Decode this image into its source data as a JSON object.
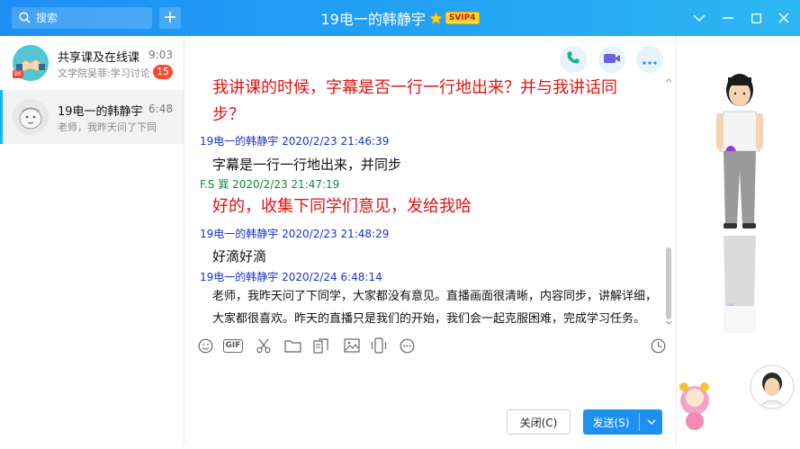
{
  "search": {
    "placeholder": "搜索"
  },
  "window": {
    "title": "19电一的韩静宇",
    "vip_badge": "SVIP4"
  },
  "conversations": [
    {
      "name": "共享课及在线课",
      "time": "9:03",
      "preview": "文学院吴菲:学习讨论",
      "badge": "15",
      "avatar_tag": "BK"
    },
    {
      "name": "19电一的韩静宇",
      "time": "6:48",
      "preview": "老师，我昨天问了下同学"
    }
  ],
  "messages": [
    {
      "text": "我讲课的时候，字幕是否一行一行地出来？并与我讲话同",
      "style": "big"
    },
    {
      "text": "步？",
      "style": "big"
    },
    {
      "sender": "19电一的韩静宇",
      "time": "2020/2/23 21:46:39"
    },
    {
      "text": "字幕是一行一行地出来，并同步",
      "style": "body"
    },
    {
      "sender": "F.S 巽",
      "time": "2020/2/23 21:47:19"
    },
    {
      "text": "好的，收集下同学们意见，发给我哈",
      "style": "big"
    },
    {
      "sender": "19电一的韩静宇",
      "time": "2020/2/23 21:48:29"
    },
    {
      "text": "好滴好滴",
      "style": "body"
    },
    {
      "sender": "19电一的韩静宇",
      "time": "2020/2/24 6:48:14"
    },
    {
      "text": "老师，我昨天问了下同学，大家都没有意见。直播画面很清晰，内容同步，讲解详细，",
      "style": "small"
    },
    {
      "text": "大家都很喜欢。昨天的直播只是我们的开始，我们会一起克服困难，完成学习任务。",
      "style": "small"
    }
  ],
  "composer": {
    "close_label": "关闭(C)",
    "send_label": "发送(S)"
  },
  "toolbar": {
    "gif_label": "GIF"
  },
  "colors": {
    "header": "#1e8ff2",
    "accent": "#12b7f5",
    "red_text": "#e11414",
    "sender_blue": "#1a33cc",
    "sender_green": "#128a3a",
    "badge_red": "#f74c31"
  },
  "icons": [
    "search-icon",
    "plus-icon",
    "star-icon",
    "chevron-down-icon",
    "minimize-icon",
    "maximize-icon",
    "close-icon",
    "phone-icon",
    "video-icon",
    "more-icon",
    "emoji-icon",
    "gif-icon",
    "scissors-icon",
    "folder-icon",
    "doc-icon",
    "image-icon",
    "shake-icon",
    "emoticon-icon",
    "history-clock-icon"
  ]
}
